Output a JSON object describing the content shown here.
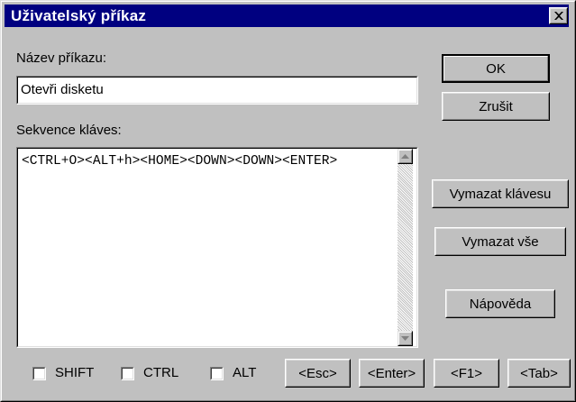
{
  "window": {
    "title": "Uživatelský příkaz",
    "close_icon": "close-icon"
  },
  "command_name": {
    "label": "Název příkazu:",
    "value": "Otevři disketu"
  },
  "key_sequence": {
    "label": "Sekvence kláves:",
    "value": "<CTRL+O><ALT+h><HOME><DOWN><DOWN><ENTER>"
  },
  "buttons": {
    "ok": "OK",
    "cancel": "Zrušit",
    "delete_key": "Vymazat klávesu",
    "delete_all": "Vymazat vše",
    "help": "Nápověda"
  },
  "modifiers": [
    {
      "label": "SHIFT",
      "checked": false
    },
    {
      "label": "CTRL",
      "checked": false
    },
    {
      "label": "ALT",
      "checked": false
    }
  ],
  "key_buttons": [
    "<Esc>",
    "<Enter>",
    "<F1>",
    "<Tab>"
  ],
  "colors": {
    "title_bar": "#000080",
    "face": "#c0c0c0"
  }
}
